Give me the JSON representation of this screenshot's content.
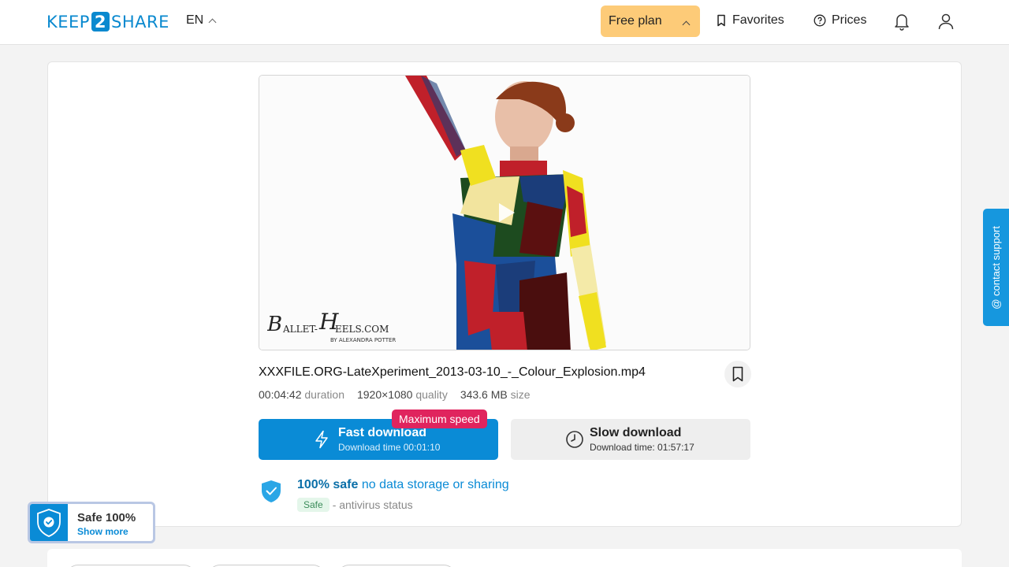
{
  "header": {
    "logo_pre": "KEEP",
    "logo_mid": "2",
    "logo_post": "SHARE",
    "lang": "EN",
    "plan": "Free plan",
    "favorites": "Favorites",
    "prices": "Prices",
    "icons": [
      "bookmark-icon",
      "help-circle-icon",
      "bell-icon",
      "user-icon"
    ]
  },
  "file": {
    "name": "XXXFILE.ORG-LateXperiment_2013-03-10_-_Colour_Explosion.mp4",
    "duration_value": "00:04:42",
    "duration_label": "duration",
    "quality_value": "1920×1080",
    "quality_label": "quality",
    "size_value": "343.6 MB",
    "size_label": "size"
  },
  "preview": {
    "watermark_main": "BALLET-HEELS.COM",
    "watermark_sub": "BY ALEXANDRA POTTER"
  },
  "download": {
    "max_speed": "Maximum speed",
    "fast_title": "Fast download",
    "fast_sub": "Download time 00:01:10",
    "slow_title": "Slow download",
    "slow_sub": "Download time: 01:57:17"
  },
  "safety": {
    "bold": "100% safe",
    "rest": "no data storage or sharing",
    "tag": "Safe",
    "status": "- antivirus status"
  },
  "support": {
    "label": "@ contact support"
  },
  "badge": {
    "title": "Safe 100%",
    "link": "Show more"
  },
  "colors": {
    "brand": "#0a8bd6",
    "plan_bg": "#fdcb78",
    "max_speed_bg": "#e0245e"
  }
}
